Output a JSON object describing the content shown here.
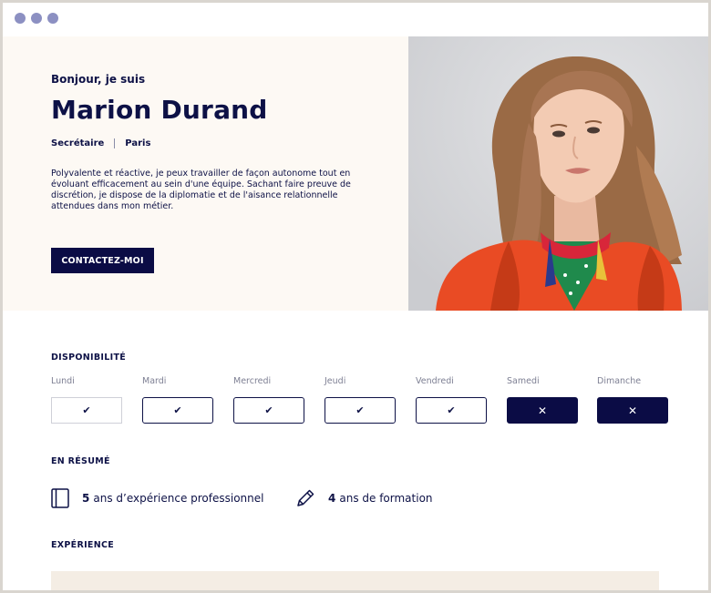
{
  "window": {
    "dots": [
      "dot-1",
      "dot-2",
      "dot-3"
    ]
  },
  "hero": {
    "greeting": "Bonjour, je suis",
    "name": "Marion Durand",
    "role": "Secrétaire",
    "city": "Paris",
    "bio": "Polyvalente et réactive, je peux travailler de façon autonome tout en évoluant efficacement au sein d'une équipe. Sachant faire preuve de discrétion, je dispose de la diplomatie et de l'aisance relationnelle attendues dans mon métier.",
    "cta_label": "CONTACTEZ-MOI"
  },
  "availability": {
    "title": "DISPONIBILITÉ",
    "days": [
      {
        "label": "Lundi",
        "status": "available",
        "mark": "✔"
      },
      {
        "label": "Mardi",
        "status": "available",
        "mark": "✔"
      },
      {
        "label": "Mercredi",
        "status": "available",
        "mark": "✔"
      },
      {
        "label": "Jeudi",
        "status": "available",
        "mark": "✔"
      },
      {
        "label": "Vendredi",
        "status": "available",
        "mark": "✔"
      },
      {
        "label": "Samedi",
        "status": "unavailable",
        "mark": "✕"
      },
      {
        "label": "Dimanche",
        "status": "unavailable",
        "mark": "✕"
      }
    ]
  },
  "summary": {
    "title": "EN RÉSUMÉ",
    "experience_years": "5",
    "experience_text": "ans d’expérience professionnel",
    "experience_icon": "book-icon",
    "training_years": "4",
    "training_text": "ans de formation",
    "training_icon": "pencil-icon"
  },
  "experience": {
    "title": "EXPÉRIENCE"
  },
  "colors": {
    "navy": "#0b0c45",
    "cream": "#fdf9f4",
    "accent_dot": "#8c90c2"
  }
}
